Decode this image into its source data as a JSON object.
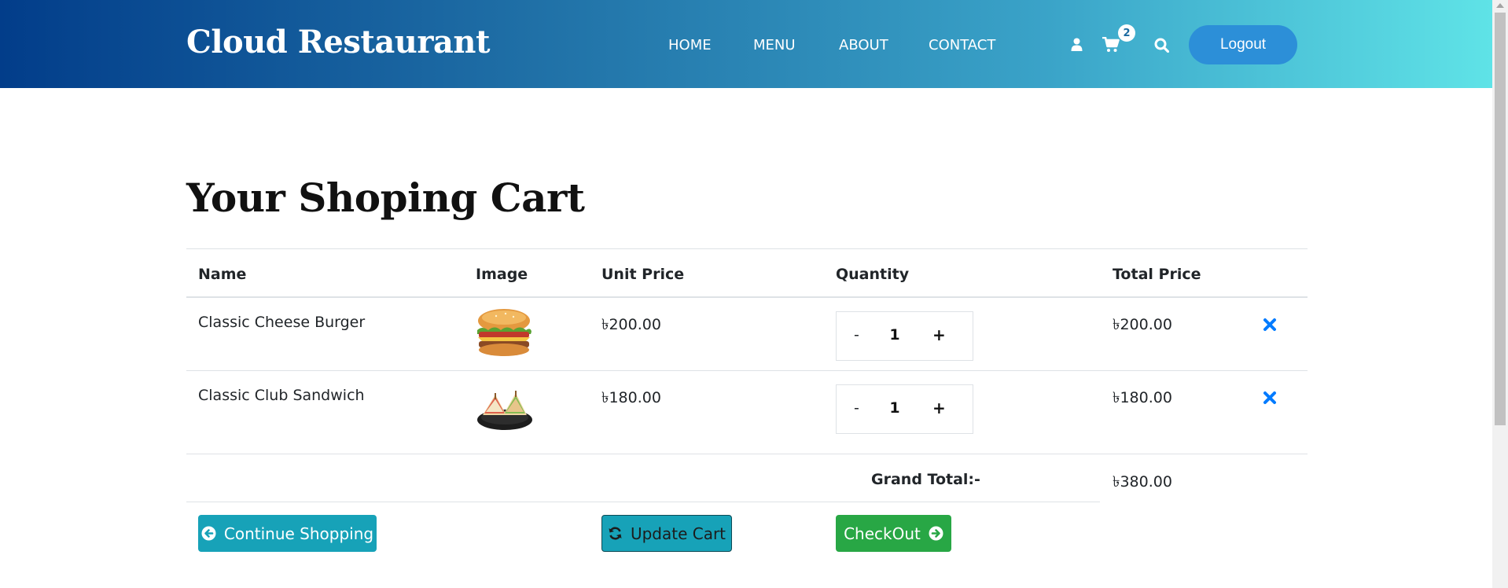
{
  "header": {
    "brand": "Cloud Restaurant",
    "nav": [
      "HOME",
      "MENU",
      "ABOUT",
      "CONTACT"
    ],
    "icons": [
      "user-icon",
      "cart-icon",
      "search-icon"
    ],
    "cart_count": "2",
    "logout_label": "Logout"
  },
  "page": {
    "title": "Your Shoping Cart"
  },
  "table": {
    "columns": [
      "Name",
      "Image",
      "Unit Price",
      "Quantity",
      "Total Price"
    ],
    "rows": [
      {
        "name": "Classic Cheese Burger",
        "image": "burger-image",
        "unit_price": "৳200.00",
        "quantity": "1",
        "total_price": "৳200.00",
        "minus": "-",
        "plus": "+"
      },
      {
        "name": "Classic Club Sandwich",
        "image": "sandwich-image",
        "unit_price": "৳180.00",
        "quantity": "1",
        "total_price": "৳180.00",
        "minus": "-",
        "plus": "+"
      }
    ],
    "grand_total_label": "Grand Total:-",
    "grand_total": "৳380.00"
  },
  "buttons": {
    "continue": "Continue Shopping",
    "update": "Update Cart",
    "checkout": "CheckOut"
  },
  "colors": {
    "header_gradient_start": "#023d8a",
    "header_gradient_end": "#5fe3e7",
    "logout": "#2c8fd8",
    "info": "#17a2b8",
    "success": "#28a745",
    "remove": "#007bff"
  }
}
